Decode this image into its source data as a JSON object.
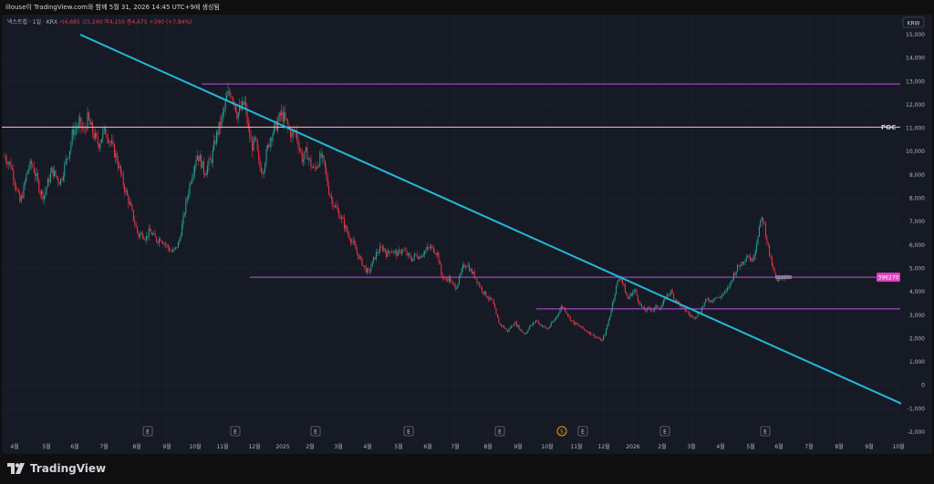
{
  "header": {
    "caption": "illouse이 TradingView.com와 함께 5월 31, 2026 14:45 UTC+9에 생성됨"
  },
  "legend": {
    "symbol": "넥스트칩 · 1일 · KRX",
    "open": "시4,685",
    "high": "고5,240",
    "low": "저4,150",
    "close": "종4,675",
    "change": "+340 (+7.84%)"
  },
  "branding": {
    "name": "TradingView"
  },
  "colors": {
    "background": "#161a25",
    "up": "#26a69a",
    "down": "#f23645",
    "trendline": "#22b8d8",
    "level_line": "#c050e0",
    "poc_line": "#ffb3c1"
  },
  "chart_data": {
    "type": "candlestick",
    "currency": "KRW",
    "y_ticks": [
      "15,000",
      "14,000",
      "13,000",
      "12,000",
      "11,000",
      "10,000",
      "9,000",
      "8,000",
      "7,000",
      "6,000",
      "5,000",
      "4,000",
      "3,000",
      "2,000",
      "1,000",
      "0",
      "-1,000",
      "-2,000"
    ],
    "y_tick_values": [
      15000,
      14000,
      13000,
      12000,
      11000,
      10000,
      9000,
      8000,
      7000,
      6000,
      5000,
      4000,
      3000,
      2000,
      1000,
      0,
      -1000,
      -2000
    ],
    "ylim": [
      -2000,
      15000
    ],
    "x_labels": [
      "4월",
      "5월",
      "6월",
      "7월",
      "8월",
      "9월",
      "10월",
      "11월",
      "12월",
      "2025",
      "2월",
      "3월",
      "4월",
      "5월",
      "6월",
      "7월",
      "8월",
      "9월",
      "10월",
      "11월",
      "12월",
      "2026",
      "2월",
      "3월",
      "4월",
      "5월",
      "6월",
      "7월",
      "8월",
      "9월",
      "10월"
    ],
    "levels": [
      {
        "label": "12,890",
        "value": 12890,
        "tag": ""
      },
      {
        "label": "11,040",
        "value": 11040,
        "tag": "POC"
      },
      {
        "label": "4,625",
        "value": 4625,
        "tag": "396270"
      },
      {
        "label": "3,270",
        "value": 3270,
        "tag": ""
      }
    ],
    "trendline": {
      "from": {
        "date": "2024-04",
        "value": 15000
      },
      "to": {
        "date": "2026-10",
        "value": -800
      }
    },
    "events": [
      "E",
      "E",
      "E",
      "E",
      "E",
      "S",
      "E",
      "E",
      "E"
    ],
    "price_path": [
      [
        0,
        9900
      ],
      [
        5,
        9700
      ],
      [
        10,
        9400
      ],
      [
        15,
        8600
      ],
      [
        20,
        7800
      ],
      [
        24,
        8400
      ],
      [
        28,
        9200
      ],
      [
        33,
        9500
      ],
      [
        37,
        9000
      ],
      [
        42,
        8300
      ],
      [
        46,
        8100
      ],
      [
        50,
        8600
      ],
      [
        55,
        9200
      ],
      [
        60,
        8900
      ],
      [
        64,
        8700
      ],
      [
        67,
        9100
      ],
      [
        71,
        9700
      ],
      [
        75,
        10200
      ],
      [
        78,
        10900
      ],
      [
        82,
        11000
      ],
      [
        86,
        11200
      ],
      [
        90,
        10800
      ],
      [
        94,
        11400
      ],
      [
        98,
        11000
      ],
      [
        102,
        10600
      ],
      [
        106,
        10300
      ],
      [
        110,
        10700
      ],
      [
        114,
        10900
      ],
      [
        118,
        10500
      ],
      [
        122,
        10100
      ],
      [
        126,
        9700
      ],
      [
        130,
        9100
      ],
      [
        134,
        8500
      ],
      [
        138,
        8000
      ],
      [
        142,
        7500
      ],
      [
        146,
        6900
      ],
      [
        150,
        6400
      ],
      [
        154,
        6500
      ],
      [
        158,
        6300
      ],
      [
        162,
        6600
      ],
      [
        166,
        6400
      ],
      [
        170,
        6200
      ],
      [
        174,
        6300
      ],
      [
        178,
        6100
      ],
      [
        182,
        5900
      ],
      [
        186,
        5700
      ],
      [
        190,
        5800
      ],
      [
        194,
        6100
      ],
      [
        198,
        6900
      ],
      [
        202,
        7800
      ],
      [
        206,
        8600
      ],
      [
        210,
        9300
      ],
      [
        214,
        9900
      ],
      [
        218,
        9600
      ],
      [
        222,
        9100
      ],
      [
        226,
        9400
      ],
      [
        230,
        9700
      ],
      [
        234,
        10500
      ],
      [
        238,
        11000
      ],
      [
        242,
        11500
      ],
      [
        246,
        12200
      ],
      [
        250,
        12600
      ],
      [
        254,
        12300
      ],
      [
        258,
        11600
      ],
      [
        262,
        11800
      ],
      [
        266,
        12100
      ],
      [
        270,
        11000
      ],
      [
        274,
        10200
      ],
      [
        278,
        10500
      ],
      [
        282,
        9400
      ],
      [
        286,
        9200
      ],
      [
        290,
        9900
      ],
      [
        294,
        10600
      ],
      [
        298,
        10900
      ],
      [
        302,
        11200
      ],
      [
        306,
        11600
      ],
      [
        310,
        11400
      ],
      [
        314,
        11000
      ],
      [
        318,
        10700
      ],
      [
        322,
        10900
      ],
      [
        326,
        10200
      ],
      [
        330,
        9600
      ],
      [
        334,
        10000
      ],
      [
        338,
        9500
      ],
      [
        342,
        9200
      ],
      [
        346,
        9500
      ],
      [
        350,
        9800
      ],
      [
        354,
        9300
      ],
      [
        358,
        8400
      ],
      [
        362,
        7900
      ],
      [
        366,
        7600
      ],
      [
        370,
        7300
      ],
      [
        374,
        7000
      ],
      [
        378,
        6600
      ],
      [
        382,
        6300
      ],
      [
        386,
        6000
      ],
      [
        390,
        5600
      ],
      [
        394,
        5300
      ],
      [
        398,
        5000
      ],
      [
        402,
        4800
      ],
      [
        406,
        5200
      ],
      [
        410,
        5600
      ],
      [
        414,
        5800
      ],
      [
        418,
        5900
      ],
      [
        422,
        5600
      ],
      [
        426,
        5800
      ],
      [
        430,
        5700
      ],
      [
        434,
        5600
      ],
      [
        438,
        5800
      ],
      [
        442,
        5700
      ],
      [
        446,
        5500
      ],
      [
        450,
        5400
      ],
      [
        454,
        5600
      ],
      [
        458,
        5500
      ],
      [
        462,
        5700
      ],
      [
        466,
        5800
      ],
      [
        470,
        5900
      ],
      [
        474,
        5800
      ],
      [
        478,
        5600
      ],
      [
        482,
        4700
      ],
      [
        486,
        4500
      ],
      [
        490,
        4600
      ],
      [
        494,
        4300
      ],
      [
        498,
        4200
      ],
      [
        502,
        4600
      ],
      [
        506,
        5100
      ],
      [
        510,
        5200
      ],
      [
        514,
        4900
      ],
      [
        518,
        4700
      ],
      [
        522,
        4400
      ],
      [
        526,
        4100
      ],
      [
        530,
        3900
      ],
      [
        534,
        3700
      ],
      [
        538,
        3600
      ],
      [
        542,
        3000
      ],
      [
        546,
        2600
      ],
      [
        550,
        2500
      ],
      [
        554,
        2300
      ],
      [
        558,
        2500
      ],
      [
        562,
        2700
      ],
      [
        566,
        2500
      ],
      [
        570,
        2300
      ],
      [
        574,
        2200
      ],
      [
        578,
        2500
      ],
      [
        582,
        2600
      ],
      [
        586,
        2800
      ],
      [
        590,
        2600
      ],
      [
        594,
        2500
      ],
      [
        598,
        2400
      ],
      [
        602,
        2600
      ],
      [
        606,
        2800
      ],
      [
        610,
        3100
      ],
      [
        614,
        3400
      ],
      [
        618,
        3200
      ],
      [
        622,
        2900
      ],
      [
        626,
        2700
      ],
      [
        630,
        2600
      ],
      [
        634,
        2500
      ],
      [
        638,
        2400
      ],
      [
        642,
        2300
      ],
      [
        646,
        2200
      ],
      [
        650,
        2100
      ],
      [
        654,
        2000
      ],
      [
        658,
        1900
      ],
      [
        662,
        2300
      ],
      [
        666,
        2900
      ],
      [
        670,
        3600
      ],
      [
        674,
        4300
      ],
      [
        678,
        4700
      ],
      [
        682,
        4200
      ],
      [
        686,
        3700
      ],
      [
        690,
        3900
      ],
      [
        694,
        4100
      ],
      [
        698,
        3600
      ],
      [
        702,
        3300
      ],
      [
        706,
        3200
      ],
      [
        710,
        3300
      ],
      [
        714,
        3200
      ],
      [
        718,
        3400
      ],
      [
        722,
        3300
      ],
      [
        726,
        3600
      ],
      [
        730,
        3900
      ],
      [
        734,
        4000
      ],
      [
        738,
        3700
      ],
      [
        742,
        3500
      ],
      [
        746,
        3300
      ],
      [
        750,
        3200
      ],
      [
        754,
        3000
      ],
      [
        758,
        2900
      ],
      [
        762,
        3000
      ],
      [
        766,
        3200
      ],
      [
        770,
        3500
      ],
      [
        774,
        3700
      ],
      [
        778,
        3600
      ],
      [
        782,
        3800
      ],
      [
        786,
        3700
      ],
      [
        790,
        3900
      ],
      [
        794,
        4000
      ],
      [
        798,
        4300
      ],
      [
        802,
        4700
      ],
      [
        806,
        5000
      ],
      [
        810,
        5200
      ],
      [
        814,
        5400
      ],
      [
        818,
        5600
      ],
      [
        822,
        5300
      ],
      [
        826,
        5800
      ],
      [
        830,
        6700
      ],
      [
        834,
        7200
      ],
      [
        838,
        6400
      ],
      [
        842,
        5500
      ],
      [
        846,
        4900
      ],
      [
        850,
        4400
      ],
      [
        854,
        4600
      ],
      [
        858,
        4650
      ],
      [
        862,
        4650
      ]
    ]
  }
}
